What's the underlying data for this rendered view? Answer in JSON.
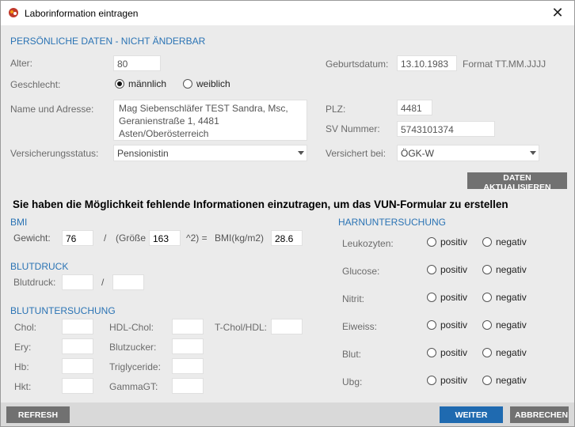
{
  "window": {
    "title": "Laborinformation eintragen",
    "close": "✕"
  },
  "personal": {
    "section": "PERSÖNLICHE DATEN - NICHT ÄNDERBAR",
    "age_label": "Alter:",
    "age_value": "80",
    "birth_label": "Geburtsdatum:",
    "birth_value": "13.10.1983",
    "birth_format": "Format TT.MM.JJJJ",
    "gender_label": "Geschlecht:",
    "gender_male": "männlich",
    "gender_female": "weiblich",
    "name_label": "Name und Adresse:",
    "name_value": "Mag Siebenschläfer TEST Sandra, Msc,\nGeranienstraße 1, 4481\nAsten/Oberösterreich",
    "plz_label": "PLZ:",
    "plz_value": "4481",
    "sv_label": "SV Nummer:",
    "sv_value": "5743101374",
    "status_label": "Versicherungsstatus:",
    "status_value": "Pensionistin",
    "insured_label": "Versichert bei:",
    "insured_value": "ÖGK-W",
    "update_button": "DATEN AKTUALISIEREN"
  },
  "banner": "Sie haben die Möglichkeit fehlende Informationen einzutragen, um das VUN-Formular zu erstellen",
  "bmi": {
    "section": "BMI",
    "weight_label": "Gewicht:",
    "weight_value": "76",
    "slash": "/",
    "height_label": "(Größe",
    "height_value": "163",
    "squared": "^2) =",
    "bmi_label": "BMI(kg/m2)",
    "bmi_value": "28.6"
  },
  "blood_pressure": {
    "section": "BLUTDRUCK",
    "label": "Blutdruck:",
    "slash": "/"
  },
  "blood_test": {
    "section": "BLUTUNTERSUCHUNG",
    "chol": "Chol:",
    "hdl": "HDL-Chol:",
    "tchol": "T-Chol/HDL:",
    "ery": "Ery:",
    "sugar": "Blutzucker:",
    "hb": "Hb:",
    "trig": "Triglyceride:",
    "hkt": "Hkt:",
    "gamma": "GammaGT:"
  },
  "urine": {
    "section": "HARNUNTERSUCHUNG",
    "positive": "positiv",
    "negative": "negativ",
    "rows": [
      "Leukozyten:",
      "Glucose:",
      "Nitrit:",
      "Eiweiss:",
      "Blut:",
      "Ubg:"
    ]
  },
  "footer": {
    "refresh": "REFRESH",
    "next": "WEITER",
    "cancel": "ABBRECHEN"
  }
}
